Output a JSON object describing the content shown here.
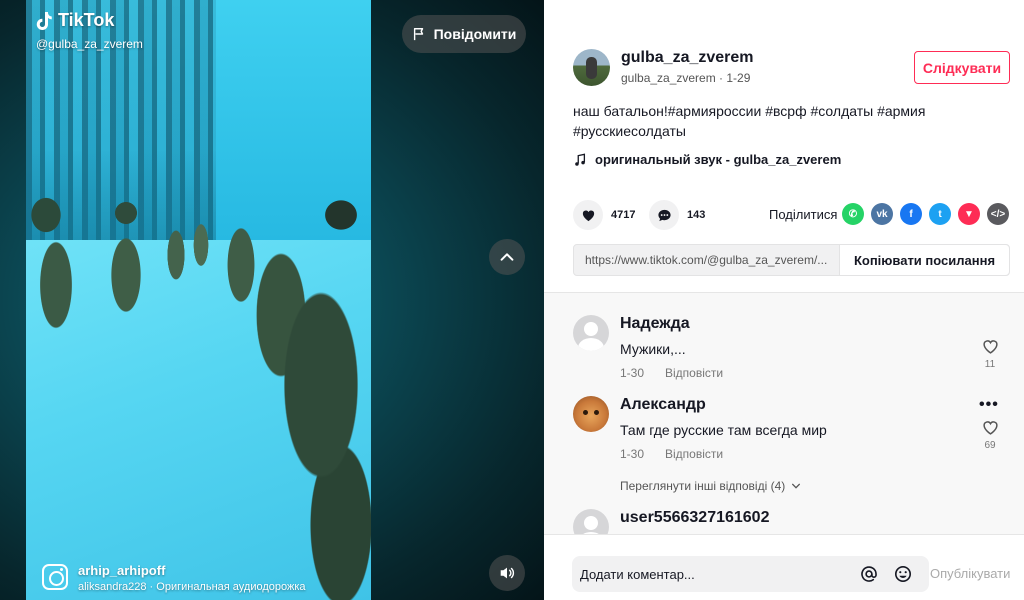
{
  "video": {
    "logo_text": "TikTok",
    "watermark_handle": "@gulba_za_zverem",
    "report_label": "Повідомити",
    "bottom_user": "arhip_arhipoff",
    "bottom_sound": "aliksandra228 · Оригинальная аудиодорожка"
  },
  "author": {
    "name": "gulba_za_zverem",
    "meta": "gulba_za_zverem · 1-29",
    "follow_label": "Слідкувати"
  },
  "post": {
    "caption": "наш батальон!#армияроссии #всрф #солдаты #армия #русскиесолдаты",
    "music": "оригинальный звук - gulba_za_zverem"
  },
  "stats": {
    "likes": "4717",
    "comments": "143"
  },
  "share": {
    "label": "Поділитися",
    "icons": [
      {
        "name": "whatsapp-icon",
        "color": "#25d366",
        "glyph": "✆"
      },
      {
        "name": "vk-icon",
        "color": "#4c75a3",
        "glyph": "vk"
      },
      {
        "name": "facebook-icon",
        "color": "#1877f2",
        "glyph": "f"
      },
      {
        "name": "twitter-icon",
        "color": "#1da1f2",
        "glyph": "t"
      },
      {
        "name": "telegram-icon",
        "color": "#fe2c55",
        "glyph": "▼"
      },
      {
        "name": "embed-icon",
        "color": "#5a5a5e",
        "glyph": "</>"
      }
    ]
  },
  "link": {
    "url": "https://www.tiktok.com/@gulba_za_zverem/...",
    "copy_label": "Копіювати посилання"
  },
  "comments": [
    {
      "name": "Надежда",
      "text": "Мужики,...",
      "date": "1-30",
      "reply": "Відповісти",
      "likes": "11"
    },
    {
      "name": "Александр",
      "text": "Там где русские там всегда мир",
      "date": "1-30",
      "reply": "Відповісти",
      "likes": "69"
    },
    {
      "name": "user5566327161602"
    }
  ],
  "view_replies": "Переглянути інші відповіді (4)",
  "comment_bar": {
    "placeholder": "Додати коментар...",
    "post_label": "Опублікувати"
  }
}
